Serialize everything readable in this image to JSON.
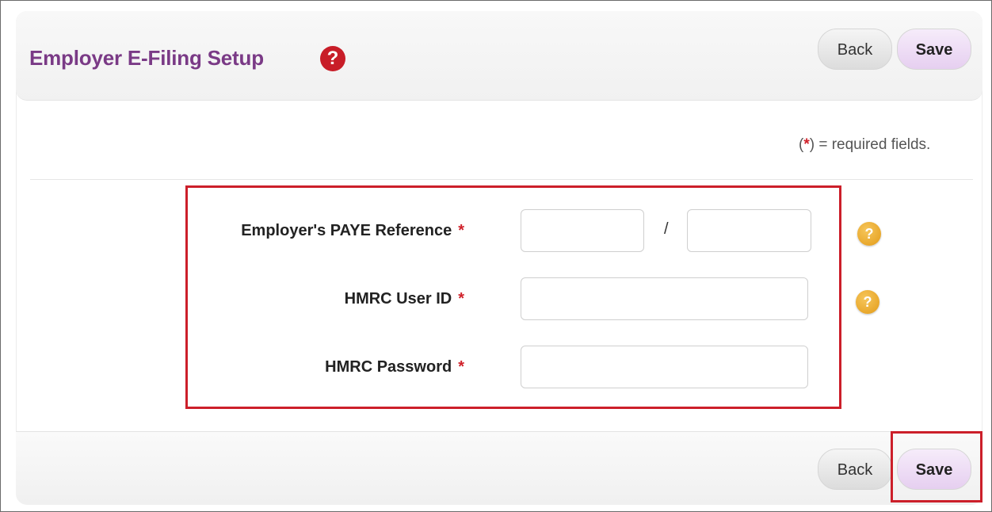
{
  "header": {
    "title": "Employer E-Filing Setup",
    "help_glyph": "?",
    "back_label": "Back",
    "save_label": "Save"
  },
  "required_note": {
    "open": "(",
    "star": "*",
    "close": ") = required fields."
  },
  "form": {
    "paye_label": "Employer's PAYE Reference",
    "paye_separator": "/",
    "user_id_label": "HMRC User ID",
    "password_label": "HMRC Password",
    "required_star": "*",
    "help_glyph": "?"
  },
  "footer": {
    "back_label": "Back",
    "save_label": "Save"
  },
  "colors": {
    "title": "#7a3a86",
    "required": "#d0212a",
    "highlight": "#cc1f2a",
    "help_red": "#c81d28",
    "help_orange": "#e39b18"
  },
  "icons": {
    "header_help": "question-circle-icon",
    "field_help": "question-circle-icon"
  }
}
